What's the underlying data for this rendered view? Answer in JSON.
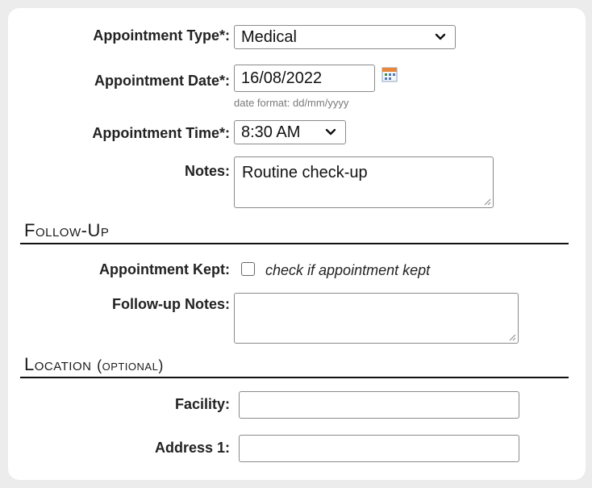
{
  "appointment": {
    "type_label": "Appointment Type*:",
    "type_value": "Medical",
    "date_label": "Appointment Date*:",
    "date_value": "16/08/2022",
    "date_hint": "date format: dd/mm/yyyy",
    "time_label": "Appointment Time*:",
    "time_value": "8:30 AM",
    "notes_label": "Notes:",
    "notes_value": "Routine check-up"
  },
  "follow_up": {
    "title": "Follow-Up",
    "kept_label": "Appointment Kept:",
    "kept_checked": false,
    "kept_hint": "check if appointment kept",
    "notes_label": "Follow-up Notes:",
    "notes_value": ""
  },
  "location": {
    "title": "Location",
    "subtitle": "(optional)",
    "facility_label": "Facility:",
    "facility_value": "",
    "address1_label": "Address 1:",
    "address1_value": ""
  },
  "icons": {
    "calendar": "calendar-icon",
    "dropdown": "chevron-down-icon",
    "resize": "resize-grip-icon"
  },
  "colors": {
    "rule": "#111111",
    "hint": "#7a7a7a"
  }
}
